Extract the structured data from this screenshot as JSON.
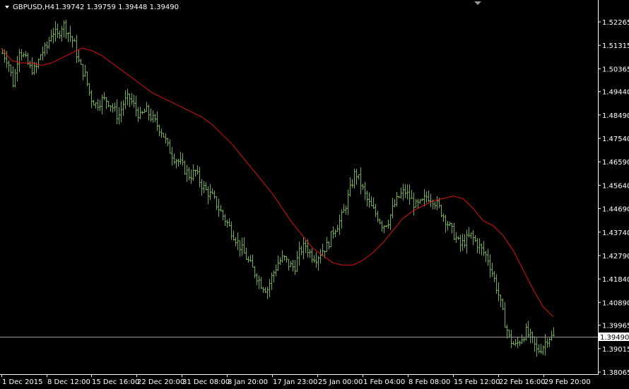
{
  "header": {
    "symbol_timeframe": "GBPUSD,H4",
    "ohlc": "1.39742 1.39759 1.39448 1.39490",
    "menu_icon": "triangle-down-icon",
    "shift_marker_icon": "triangle-down-icon"
  },
  "colors": {
    "background": "#000000",
    "bars": "#6fae4a",
    "moving_average": "#e01010",
    "price_line": "#9a9a9a",
    "text": "#ffffff",
    "axis": "#ffffff"
  },
  "current_price": {
    "label": "1.39490",
    "value": 1.3949
  },
  "chart_data": {
    "type": "ohlc-bar",
    "x_tick_labels": [
      "1 Dec 2015",
      "8 Dec 12:00",
      "15 Dec 16:00",
      "22 Dec 20:00",
      "31 Dec 08:00",
      "8 Jan 20:00",
      "17 Jan 23:00",
      "25 Jan 00:00",
      "1 Feb 04:00",
      "8 Feb 08:00",
      "15 Feb 12:00",
      "22 Feb 16:00",
      "29 Feb 20:00"
    ],
    "y_tick_labels": [
      "1.52265",
      "1.51315",
      "1.50365",
      "1.49440",
      "1.48490",
      "1.47540",
      "1.46590",
      "1.45640",
      "1.44690",
      "1.43740",
      "1.42790",
      "1.41840",
      "1.40890",
      "1.39965",
      "1.39015",
      "1.38065"
    ],
    "ylim": [
      1.38065,
      1.52265
    ],
    "close_path": [
      1.51,
      1.507,
      1.497,
      1.512,
      1.508,
      1.504,
      1.503,
      1.51,
      1.512,
      1.519,
      1.517,
      1.522,
      1.518,
      1.514,
      1.505,
      1.501,
      1.492,
      1.489,
      1.491,
      1.491,
      1.488,
      1.484,
      1.49,
      1.492,
      1.488,
      1.484,
      1.487,
      1.484,
      1.481,
      1.478,
      1.472,
      1.468,
      1.466,
      1.463,
      1.46,
      1.462,
      1.457,
      1.454,
      1.452,
      1.448,
      1.444,
      1.44,
      1.436,
      1.432,
      1.428,
      1.424,
      1.42,
      1.416,
      1.414,
      1.42,
      1.425,
      1.427,
      1.424,
      1.423,
      1.43,
      1.432,
      1.428,
      1.427,
      1.43,
      1.432,
      1.438,
      1.441,
      1.446,
      1.454,
      1.462,
      1.457,
      1.451,
      1.447,
      1.444,
      1.44,
      1.442,
      1.448,
      1.452,
      1.454,
      1.451,
      1.448,
      1.449,
      1.452,
      1.451,
      1.448,
      1.444,
      1.44,
      1.436,
      1.432,
      1.434,
      1.436,
      1.433,
      1.43,
      1.427,
      1.42,
      1.412,
      1.402,
      1.394,
      1.391,
      1.394,
      1.397,
      1.394,
      1.389,
      1.391,
      1.395,
      1.3949
    ],
    "moving_average": [
      1.512,
      1.507,
      1.506,
      1.506,
      1.505,
      1.506,
      1.508,
      1.51,
      1.512,
      1.511,
      1.509,
      1.506,
      1.503,
      1.5,
      1.497,
      1.494,
      1.492,
      1.49,
      1.488,
      1.486,
      1.484,
      1.481,
      1.477,
      1.473,
      1.468,
      1.463,
      1.458,
      1.453,
      1.447,
      1.441,
      1.436,
      1.431,
      1.428,
      1.425,
      1.424,
      1.424,
      1.426,
      1.429,
      1.433,
      1.438,
      1.443,
      1.446,
      1.448,
      1.45,
      1.451,
      1.452,
      1.451,
      1.447,
      1.442,
      1.44,
      1.436,
      1.43,
      1.422,
      1.414,
      1.407,
      1.403
    ],
    "grid": false,
    "legend": "none"
  }
}
